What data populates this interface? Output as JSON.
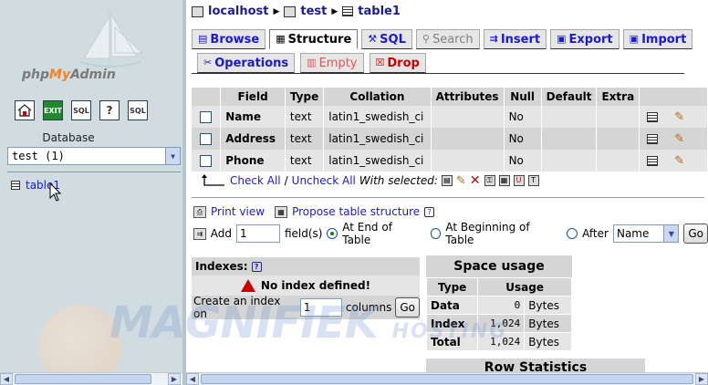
{
  "left": {
    "logo": {
      "php": "php",
      "my": "My",
      "admin": "Admin"
    },
    "icons": [
      "home-icon",
      "exit-icon",
      "sql-icon",
      "help-icon",
      "docs-icon"
    ],
    "database_label": "Database",
    "database_select": "test (1)",
    "tables": [
      {
        "label": "table1"
      }
    ]
  },
  "breadcrumb": {
    "server": "localhost",
    "database": "test",
    "table": "table1"
  },
  "tabs_row1": [
    {
      "label": "Browse",
      "icon": "browse-icon",
      "state": "normal"
    },
    {
      "label": "Structure",
      "icon": "structure-icon",
      "state": "active"
    },
    {
      "label": "SQL",
      "icon": "sql-icon",
      "state": "normal"
    },
    {
      "label": "Search",
      "icon": "search-icon",
      "state": "normal"
    },
    {
      "label": "Insert",
      "icon": "insert-icon",
      "state": "normal"
    },
    {
      "label": "Export",
      "icon": "export-icon",
      "state": "normal"
    },
    {
      "label": "Import",
      "icon": "import-icon",
      "state": "normal"
    }
  ],
  "tabs_row2": [
    {
      "label": "Operations",
      "icon": "operations-icon",
      "state": "normal"
    },
    {
      "label": "Empty",
      "icon": "empty-icon",
      "state": "red-disabled"
    },
    {
      "label": "Drop",
      "icon": "drop-icon",
      "state": "red"
    }
  ],
  "structure": {
    "headers": [
      "Field",
      "Type",
      "Collation",
      "Attributes",
      "Null",
      "Default",
      "Extra"
    ],
    "rows": [
      {
        "field": "Name",
        "type": "text",
        "collation": "latin1_swedish_ci",
        "attributes": "",
        "null": "No",
        "default": "",
        "extra": ""
      },
      {
        "field": "Address",
        "type": "text",
        "collation": "latin1_swedish_ci",
        "attributes": "",
        "null": "No",
        "default": "",
        "extra": ""
      },
      {
        "field": "Phone",
        "type": "text",
        "collation": "latin1_swedish_ci",
        "attributes": "",
        "null": "No",
        "default": "",
        "extra": ""
      }
    ],
    "check_all": "Check All",
    "uncheck_all": "Uncheck All",
    "with_selected": "With selected:",
    "separator": "/"
  },
  "actions": {
    "print_view": "Print view",
    "propose": "Propose table structure"
  },
  "add_field": {
    "add_label": "Add",
    "count": "1",
    "fields_label": "field(s)",
    "at_end": "At End of Table",
    "at_beginning": "At Beginning of Table",
    "after": "After",
    "after_select": "Name",
    "go": "Go"
  },
  "indexes": {
    "title": "Indexes:",
    "none": "No index defined!",
    "create_prefix": "Create an index on",
    "create_count": "1",
    "create_suffix": "columns",
    "go": "Go"
  },
  "space_usage": {
    "title": "Space usage",
    "headers": [
      "Type",
      "Usage"
    ],
    "rows": [
      {
        "type": "Data",
        "value": "0",
        "unit": "Bytes"
      },
      {
        "type": "Index",
        "value": "1,024",
        "unit": "Bytes"
      },
      {
        "type": "Total",
        "value": "1,024",
        "unit": "Bytes"
      }
    ]
  },
  "row_statistics": {
    "title": "Row Statistics"
  },
  "watermark": {
    "main": "MAGNIFIEK",
    "sub": "HOSTING"
  }
}
